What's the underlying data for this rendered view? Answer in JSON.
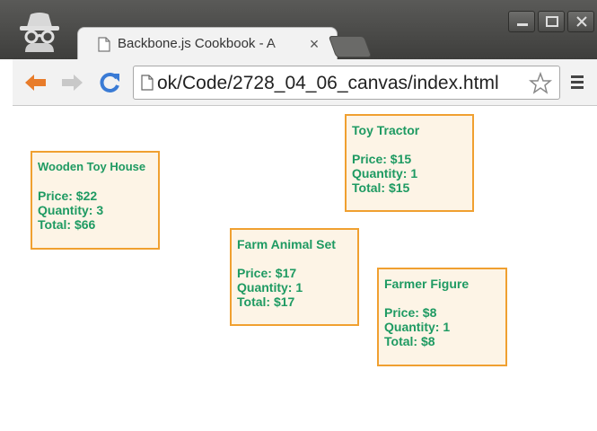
{
  "tab": {
    "title": "Backbone.js Cookbook - A",
    "close": "×"
  },
  "address_bar": {
    "url": "ok/Code/2728_04_06_canvas/index.html"
  },
  "products": [
    {
      "name": "Wooden Toy House",
      "price": "Price: $22",
      "quantity": "Quantity: 3",
      "total": "Total: $66"
    },
    {
      "name": "Toy Tractor",
      "price": "Price: $15",
      "quantity": "Quantity: 1",
      "total": "Total: $15"
    },
    {
      "name": "Farm Animal Set",
      "price": "Price: $17",
      "quantity": "Quantity: 1",
      "total": "Total: $17"
    },
    {
      "name": "Farmer Figure",
      "price": "Price: $8",
      "quantity": "Quantity: 1",
      "total": "Total: $8"
    }
  ],
  "colors": {
    "card_border": "#f0a030",
    "card_fill": "#fdf4e6",
    "card_text": "#1e9a62",
    "back_arrow": "#e87c2a",
    "reload": "#3a7bd5"
  },
  "icons": [
    "incognito-icon",
    "page-icon",
    "close-icon",
    "back-arrow-icon",
    "forward-arrow-icon",
    "reload-icon",
    "star-icon",
    "menu-icon",
    "minimize-icon",
    "maximize-icon",
    "window-close-icon"
  ]
}
